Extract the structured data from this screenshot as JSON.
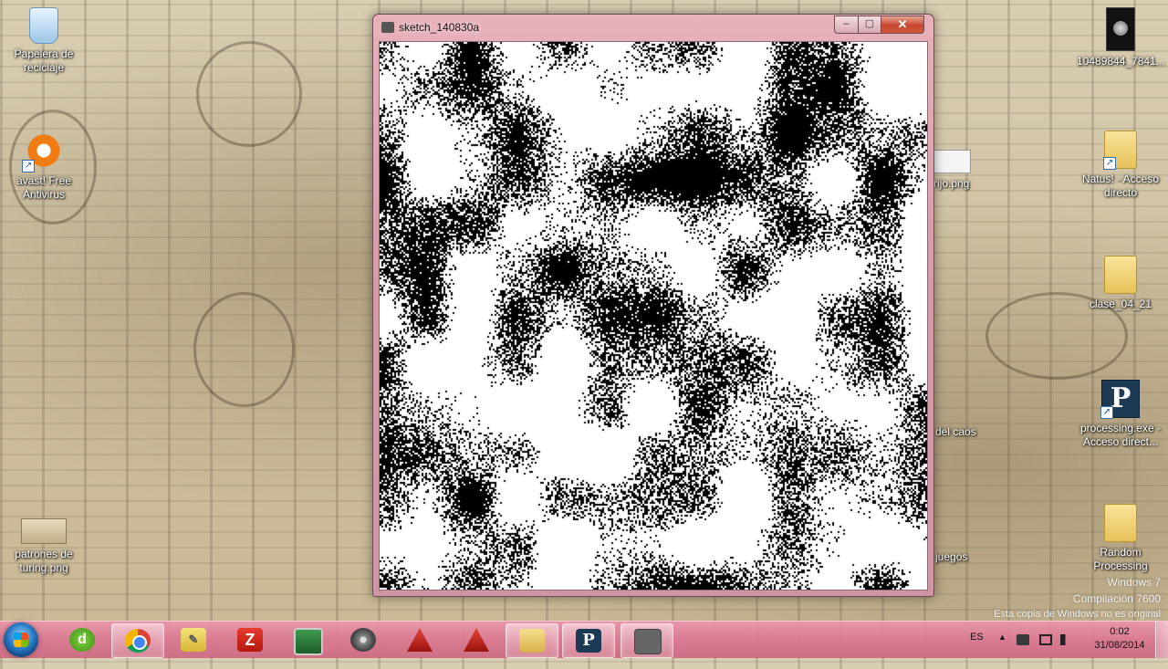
{
  "desktop": {
    "icons_left": [
      {
        "label": "Papelera de\nreciclaje",
        "icon": "recycle-bin-icon"
      },
      {
        "label": "avast! Free\nAntivirus",
        "icon": "avast-icon"
      },
      {
        "label": "patrones de\nturing.png",
        "icon": "image-file-icon"
      }
    ],
    "icons_right": [
      {
        "label": "10489844_7841...",
        "icon": "image-file-icon"
      },
      {
        "label": "Natus! - Acceso\ndirecto",
        "icon": "folder-shortcut-icon"
      },
      {
        "label": "clase_04_21",
        "icon": "folder-icon"
      },
      {
        "label": "processing.exe -\nAcceso direct...",
        "icon": "processing-icon"
      },
      {
        "label": "Random\nProcessing",
        "icon": "folder-icon"
      }
    ],
    "icons_partial": [
      {
        "label": "rijo.png"
      },
      {
        "label": "del caos"
      },
      {
        "label": "juegos"
      }
    ]
  },
  "window": {
    "title": "sketch_140830a",
    "controls": {
      "minimize": "‒",
      "maximize": "▢",
      "close": "✕"
    }
  },
  "watermark": {
    "line1": "Windows 7",
    "line2": "Compilación 7600",
    "line3": "Esta copia de Windows no es original"
  },
  "taskbar": {
    "apps": [
      {
        "name": "dreamweaver",
        "glyph": "d"
      },
      {
        "name": "chrome",
        "glyph": ""
      },
      {
        "name": "sticky-notes",
        "glyph": "✎"
      },
      {
        "name": "filezilla",
        "glyph": "Z"
      },
      {
        "name": "monitor",
        "glyph": ""
      },
      {
        "name": "disc",
        "glyph": ""
      },
      {
        "name": "autocad-1",
        "glyph": ""
      },
      {
        "name": "autocad-2",
        "glyph": ""
      },
      {
        "name": "explorer",
        "glyph": ""
      },
      {
        "name": "processing",
        "glyph": "P"
      },
      {
        "name": "sketch",
        "glyph": ""
      }
    ],
    "tray": {
      "language": "ES",
      "show_hidden": "▲",
      "time": "0:02",
      "date": "31/08/2014"
    }
  },
  "colors": {
    "taskbar": "#da7891",
    "window_frame": "#d79ca8",
    "canvas_bg": "#ffffff",
    "fractal": "#000000"
  }
}
